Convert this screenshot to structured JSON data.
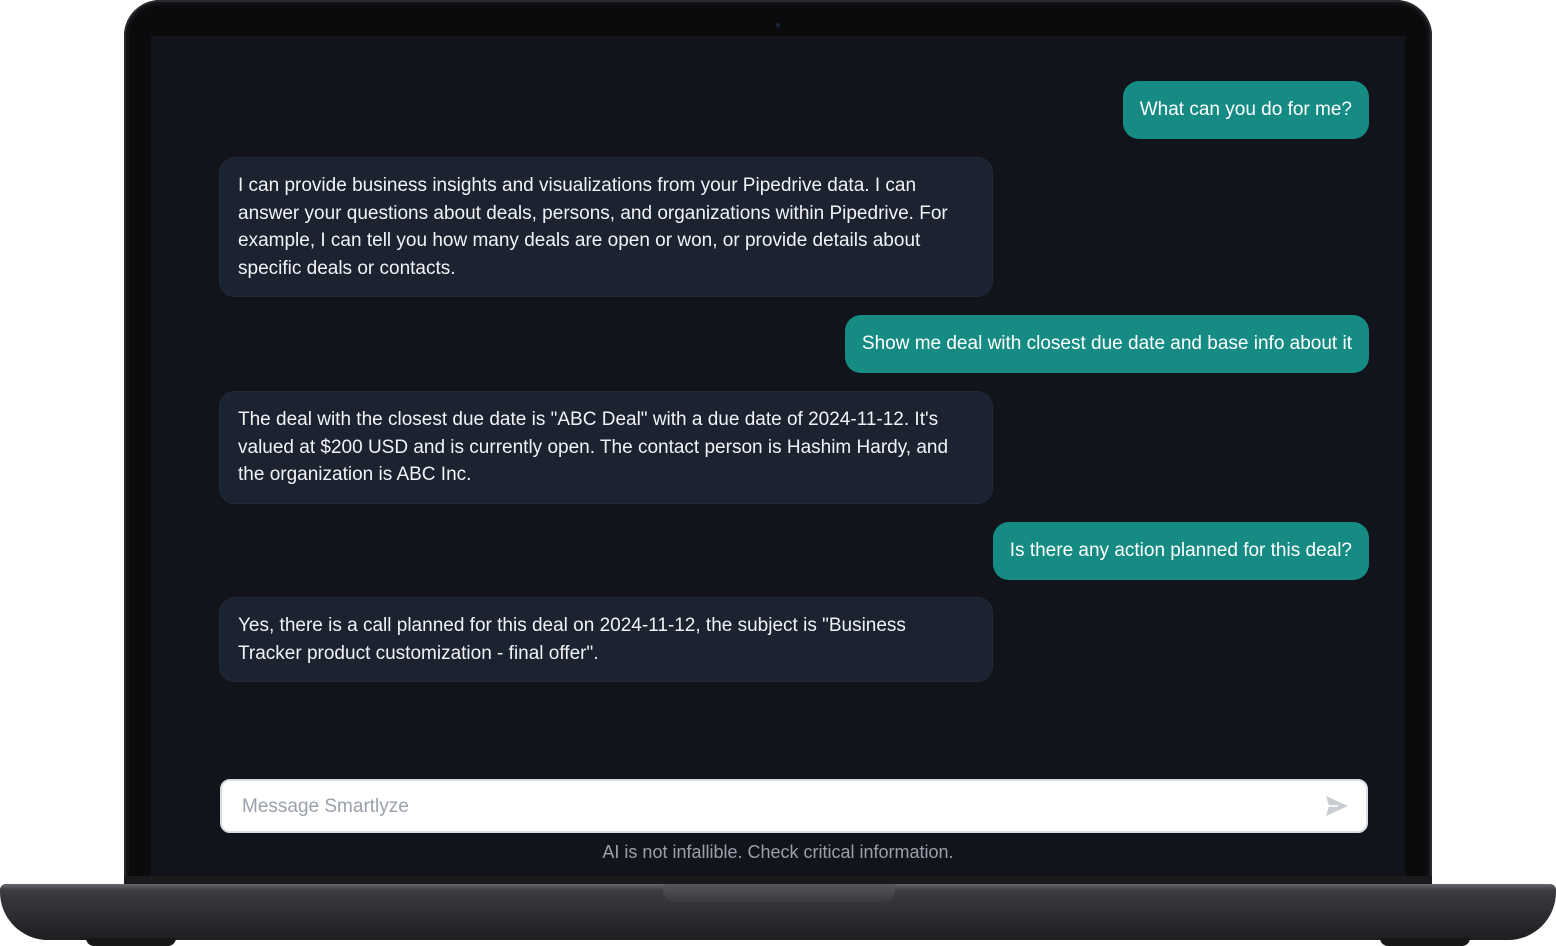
{
  "chat": {
    "messages": [
      {
        "role": "user",
        "text": "What can you do for me?"
      },
      {
        "role": "assistant",
        "text": "I can provide business insights and visualizations from your Pipedrive data.  I can answer your questions about deals, persons, and organizations within Pipedrive.  For example, I can tell you how many deals are open or won, or provide details about specific deals or contacts."
      },
      {
        "role": "user",
        "text": "Show me deal with closest due date and base info about it"
      },
      {
        "role": "assistant",
        "text": "The deal with the closest due date is \"ABC Deal\" with a due date of 2024-11-12.  It's valued at $200 USD and is currently open.  The contact person is Hashim Hardy, and the organization is ABC Inc."
      },
      {
        "role": "user",
        "text": "Is there any action planned for this deal?"
      },
      {
        "role": "assistant",
        "text": "Yes, there is a call planned for this deal on 2024-11-12,  the subject is \"Business Tracker product customization - final offer\"."
      }
    ]
  },
  "composer": {
    "placeholder": "Message Smartlyze",
    "value": "",
    "send_icon": "send-icon"
  },
  "footer": {
    "disclaimer": "AI is not infallible. Check critical information."
  },
  "colors": {
    "user_bubble": "#158b84",
    "assistant_bubble": "#1b2230",
    "screen_bg": "#11141b"
  }
}
